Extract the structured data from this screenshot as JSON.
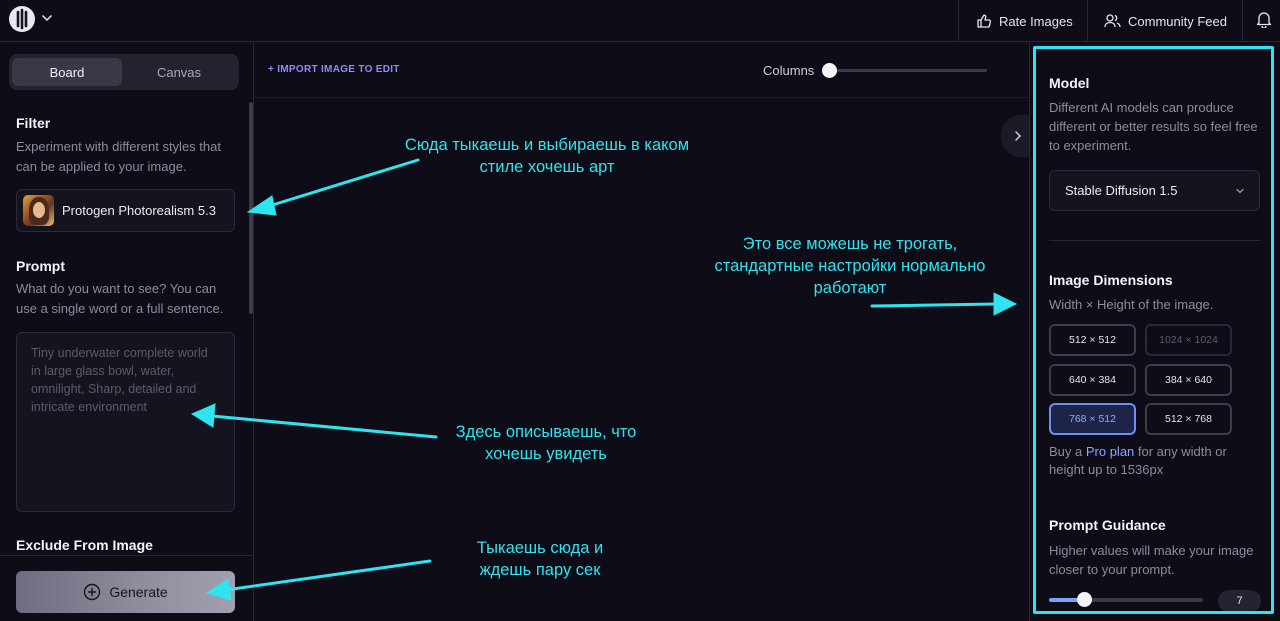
{
  "topbar": {
    "rate_images": "Rate Images",
    "community_feed": "Community Feed",
    "icons": [
      "logo-icon",
      "chevron-down-icon",
      "thumbs-up-icon",
      "users-icon",
      "bell-icon"
    ]
  },
  "left": {
    "tabs": [
      {
        "label": "Board",
        "active": true
      },
      {
        "label": "Canvas",
        "active": false
      }
    ],
    "filter": {
      "title": "Filter",
      "description": "Experiment with different styles that can be applied to your image.",
      "selected": "Protogen Photorealism 5.3"
    },
    "prompt": {
      "title": "Prompt",
      "description": "What do you want to see? You can use a single word or a full sentence.",
      "placeholder": "Tiny underwater complete world in large glass bowl, water, omnilight, Sharp, detailed and intricate environment"
    },
    "exclude": {
      "title": "Exclude From Image"
    },
    "generate_label": "Generate"
  },
  "center": {
    "import_link": "+ IMPORT IMAGE TO EDIT",
    "columns_label": "Columns"
  },
  "right": {
    "model": {
      "title": "Model",
      "description": "Different AI models can produce different or better results so feel free to experiment.",
      "selected": "Stable Diffusion 1.5"
    },
    "dimensions": {
      "title": "Image Dimensions",
      "description": "Width × Height of the image.",
      "options": [
        {
          "label": "512 × 512",
          "state": "normal"
        },
        {
          "label": "1024 × 1024",
          "state": "disabled"
        },
        {
          "label": "640 × 384",
          "state": "normal"
        },
        {
          "label": "384 × 640",
          "state": "normal"
        },
        {
          "label": "768 × 512",
          "state": "selected"
        },
        {
          "label": "512 × 768",
          "state": "normal"
        }
      ],
      "pro_prefix": "Buy a ",
      "pro_link": "Pro plan",
      "pro_suffix": " for any width or height up to 1536px"
    },
    "guidance": {
      "title": "Prompt Guidance",
      "description": "Higher values will make your image closer to your prompt.",
      "value": "7"
    }
  },
  "annotations": {
    "filter_note": "Сюда тыкаешь и выбираешь в каком стиле хочешь арт",
    "settings_note": "Это все можешь не трогать, стандартные настройки нормально работают",
    "prompt_note": "Здесь описываешь, что хочешь увидеть",
    "generate_note": "Тыкаешь сюда и ждешь пару сек"
  },
  "colors": {
    "accent_annotation": "#2ee4ee",
    "background": "#0d0c17",
    "selected_dimension": "#6b8ff2",
    "link": "#8f8df5"
  }
}
